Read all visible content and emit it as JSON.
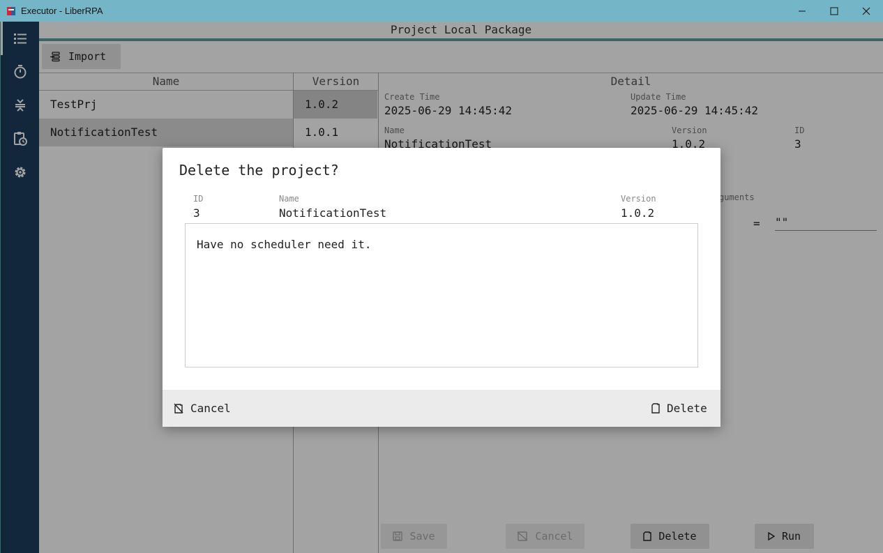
{
  "window": {
    "title": "Executor - LiberRPA",
    "controls": [
      "minimize",
      "maximize",
      "close"
    ]
  },
  "sidebar": {
    "items": [
      {
        "icon": "list-icon",
        "active": true
      },
      {
        "icon": "timer-icon",
        "active": false
      },
      {
        "icon": "collapse-icon",
        "active": false
      },
      {
        "icon": "clipboard-clock-icon",
        "active": false
      },
      {
        "icon": "gear-icon",
        "active": false
      }
    ]
  },
  "page": {
    "title": "Project Local Package",
    "import_label": "Import"
  },
  "table": {
    "headers": {
      "name": "Name",
      "version": "Version",
      "detail": "Detail"
    },
    "rows": [
      {
        "name": "TestPrj",
        "version": "1.0.2"
      },
      {
        "name": "NotificationTest",
        "version": "1.0.1"
      }
    ]
  },
  "detail": {
    "create_time_label": "Create Time",
    "create_time": "2025-06-29 14:45:42",
    "update_time_label": "Update Time",
    "update_time": "2025-06-29 14:45:42",
    "name_label": "Name",
    "name": "NotificationTest",
    "version_label": "Version",
    "version": "1.0.2",
    "id_label": "ID",
    "id": "3",
    "arguments_label": "guments",
    "equals": "=",
    "arg_value": "\"\""
  },
  "actions": {
    "save": "Save",
    "cancel": "Cancel",
    "delete": "Delete",
    "run": "Run"
  },
  "dialog": {
    "title": "Delete the project?",
    "id_label": "ID",
    "id": "3",
    "name_label": "Name",
    "name": "NotificationTest",
    "version_label": "Version",
    "version": "1.0.2",
    "message": "Have no scheduler need it.",
    "cancel_label": "Cancel",
    "delete_label": "Delete"
  }
}
